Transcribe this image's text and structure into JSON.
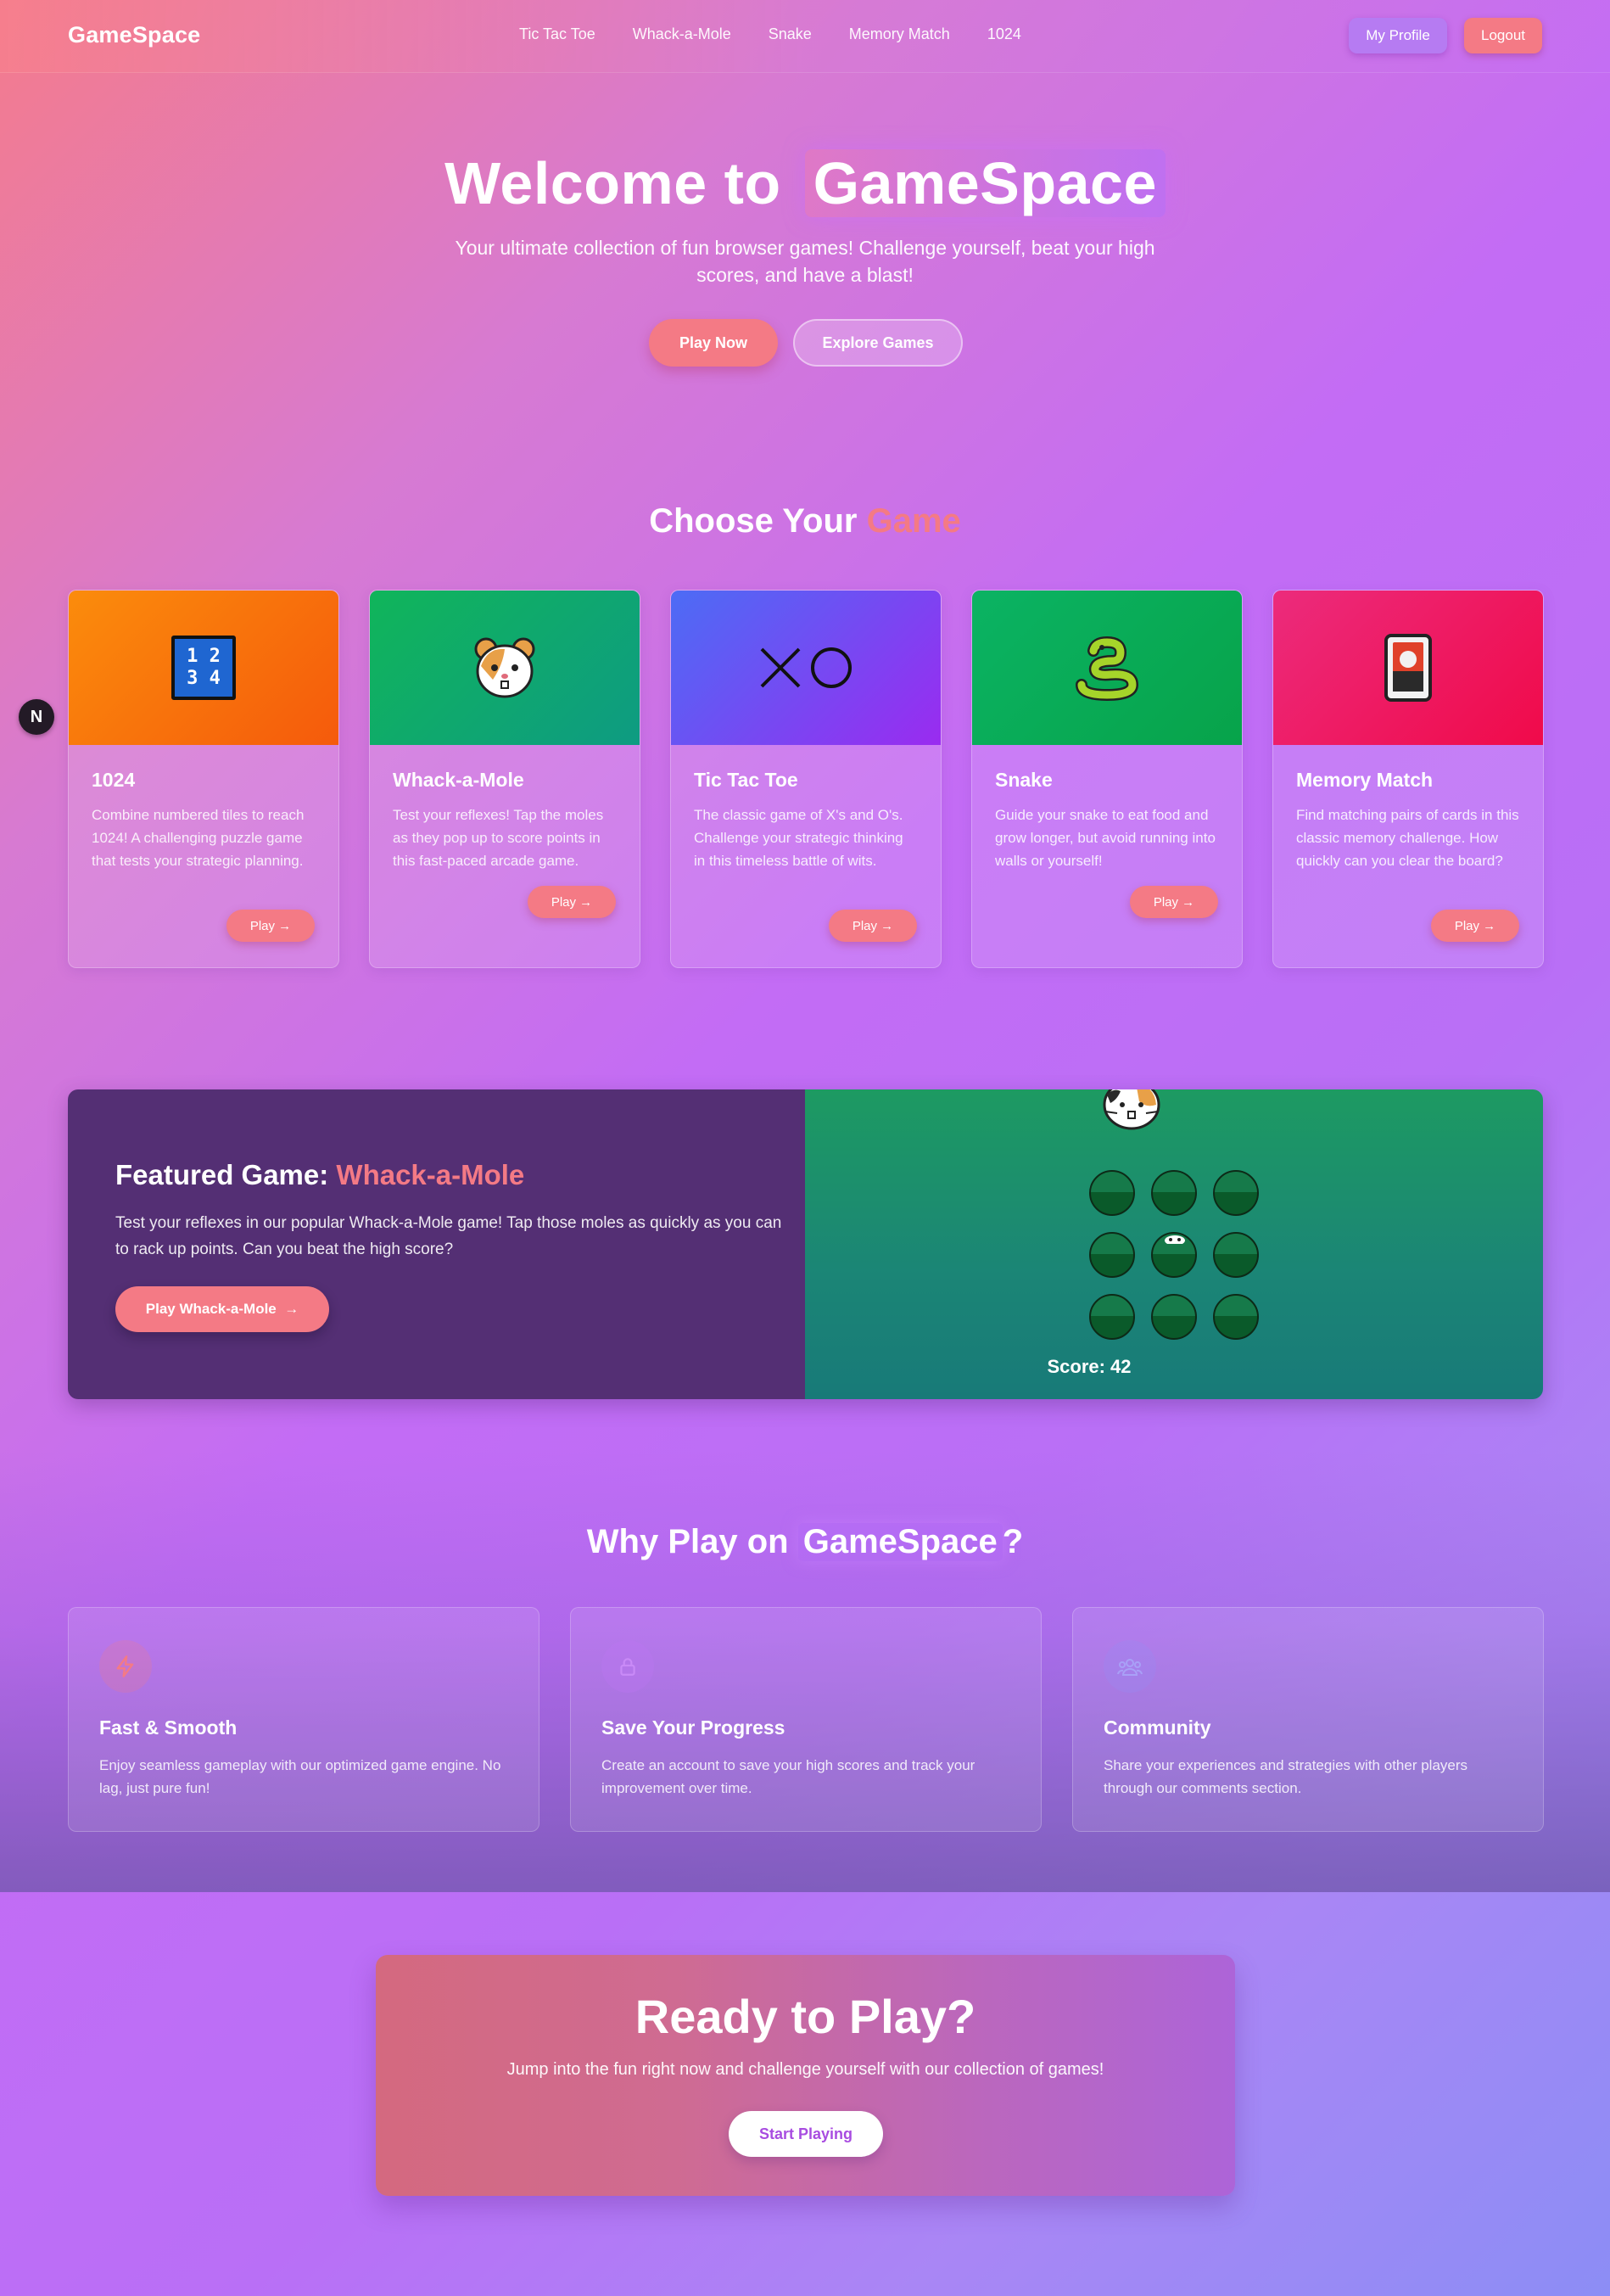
{
  "nav": {
    "brand": "GameSpace",
    "links": [
      "Tic Tac Toe",
      "Whack-a-Mole",
      "Snake",
      "Memory Match",
      "1024"
    ],
    "profile_label": "My Profile",
    "logout_label": "Logout"
  },
  "hero": {
    "title_prefix": "Welcome to",
    "title_highlight": "GameSpace",
    "subtitle": "Your ultimate collection of fun browser games! Challenge yourself, beat your high scores, and have a blast!",
    "play_now": "Play Now",
    "explore": "Explore Games"
  },
  "floating_badge": "N",
  "games_section": {
    "title_prefix": "Choose Your",
    "title_accent": "Game"
  },
  "games": [
    {
      "title": "1024",
      "desc": "Combine numbered tiles to reach 1024! A challenging puzzle game that tests your strategic planning.",
      "play": "Play",
      "icon": "numbers-tile-icon",
      "tile_text": [
        "1 2",
        "3 4"
      ]
    },
    {
      "title": "Whack-a-Mole",
      "desc": "Test your reflexes! Tap the moles as they pop up to score points in this fast-paced arcade game.",
      "play": "Play",
      "icon": "hamster-icon"
    },
    {
      "title": "Tic Tac Toe",
      "desc": "The classic game of X's and O's. Challenge your strategic thinking in this timeless battle of wits.",
      "play": "Play",
      "icon": "x-o-icon"
    },
    {
      "title": "Snake",
      "desc": "Guide your snake to eat food and grow longer, but avoid running into walls or yourself!",
      "play": "Play",
      "icon": "snake-icon"
    },
    {
      "title": "Memory Match",
      "desc": "Find matching pairs of cards in this classic memory challenge. How quickly can you clear the board?",
      "play": "Play",
      "icon": "card-icon"
    }
  ],
  "featured": {
    "title_prefix": "Featured Game:",
    "title_accent": "Whack-a-Mole",
    "desc": "Test your reflexes in our popular Whack-a-Mole game! Tap those moles as quickly as you can to rack up points. Can you beat the high score?",
    "button": "Play Whack-a-Mole",
    "score": "Score: 42"
  },
  "why": {
    "title_prefix": "Why Play on",
    "title_highlight": "GameSpace",
    "title_suffix": "?",
    "features": [
      {
        "title": "Fast & Smooth",
        "desc": "Enjoy seamless gameplay with our optimized game engine. No lag, just pure fun!",
        "icon": "lightning-icon"
      },
      {
        "title": "Save Your Progress",
        "desc": "Create an account to save your high scores and track your improvement over time.",
        "icon": "lock-icon"
      },
      {
        "title": "Community",
        "desc": "Share your experiences and strategies with other players through our comments section.",
        "icon": "users-icon"
      }
    ]
  },
  "cta": {
    "title": "Ready to Play?",
    "subtitle": "Jump into the fun right now and challenge yourself with our collection of games!",
    "button": "Start Playing"
  },
  "colors": {
    "accent": "#f47a85",
    "purple": "#b67bf2",
    "featured_left": "#542f74",
    "featured_right": "#1b8576"
  }
}
